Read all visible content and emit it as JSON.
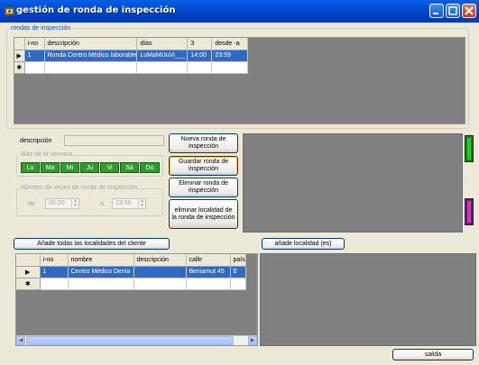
{
  "window": {
    "title": "gestión de ronda de inspección",
    "icon": "app-icon"
  },
  "rondas": {
    "group_label": "rondas de inspección",
    "columns": [
      "i-no",
      "descripción",
      "días",
      "3",
      "desde -a"
    ],
    "rows": [
      {
        "marker": "▶",
        "cells": [
          "1",
          "Ronda Centro Médico laborable",
          "LuMaMiJuVi___",
          "14:00",
          "23:59"
        ]
      },
      {
        "marker": "✱",
        "cells": [
          "",
          "",
          "",
          "",
          ""
        ]
      }
    ]
  },
  "form": {
    "descripcion_label": "descripción",
    "descripcion_value": "",
    "dias_label": "días de la semana",
    "days": [
      "Lu",
      "Ma",
      "Mi",
      "Ju",
      "Vi",
      "Sá",
      "Do"
    ],
    "numero_label": "Número de veces de ronda de inspección",
    "de_label": "de",
    "de_value": "00:00",
    "a_label": "a",
    "a_value": "23:59"
  },
  "buttons": {
    "nueva": "Nueva ronda de inspección",
    "guardar": "Guardar ronda de inspección",
    "eliminar": "Eliminar ronda de inspección",
    "eliminar_localidad": "eliminar localidad de la ronda de inspección",
    "anade_todas": "Añade todas las localidades del cliente",
    "anade_localidad": "añade localidad (es)",
    "salida": "salida"
  },
  "indicators": {
    "green": "#1ed41e",
    "purple": "#c23cc2"
  },
  "localidades": {
    "columns": [
      "i-no",
      "nombre",
      "descripción",
      "calle",
      "país"
    ],
    "rows": [
      {
        "marker": "▶",
        "cells": [
          "1",
          "Centro Médico Denia",
          "",
          "Beniamut 45",
          "E"
        ]
      },
      {
        "marker": "✱",
        "cells": [
          "",
          "",
          "",
          "",
          ""
        ]
      }
    ]
  },
  "colors": {
    "selection": "#316ac5",
    "day_active": "#2e9d2e",
    "titlebar": "#0047d1"
  }
}
